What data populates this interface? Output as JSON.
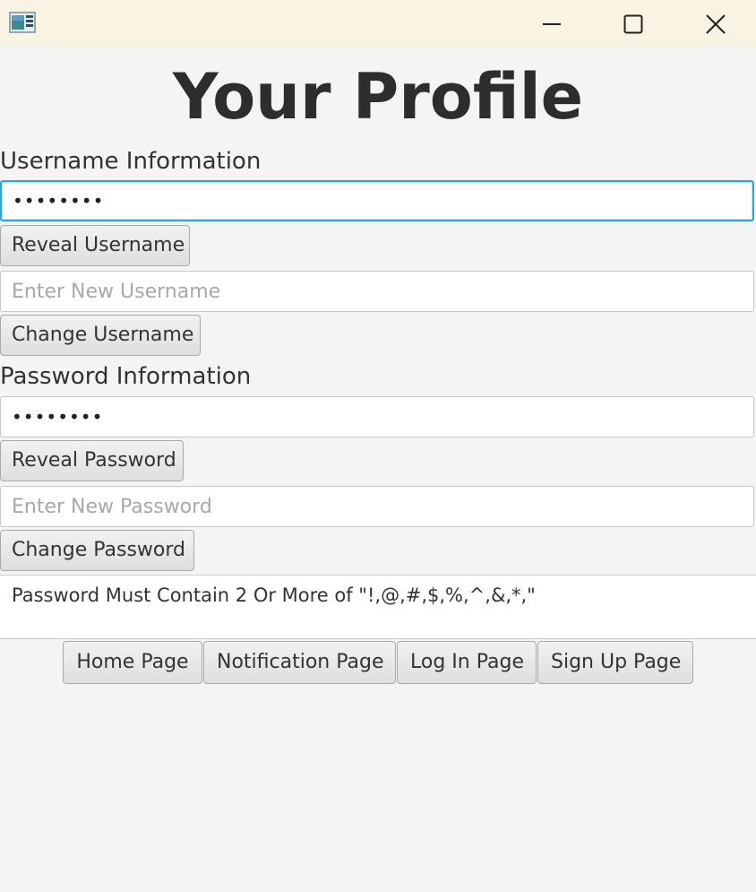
{
  "window": {
    "icons": {
      "app": "app-window-icon",
      "minimize": "minimize-icon",
      "maximize": "maximize-icon",
      "close": "close-icon"
    }
  },
  "page": {
    "title": "Your Profile"
  },
  "username_section": {
    "label": "Username Information",
    "current_value": "••••••••",
    "reveal_button": "Reveal Username",
    "new_placeholder": "Enter New Username",
    "new_value": "",
    "change_button": "Change Username"
  },
  "password_section": {
    "label": "Password Information",
    "current_value": "••••••••",
    "reveal_button": "Reveal Password",
    "new_placeholder": "Enter New Password",
    "new_value": "",
    "change_button": "Change Password"
  },
  "requirement_note": "Password Must Contain 2 Or More of \"!,@,#,$,%,^,&,*,\"",
  "nav": {
    "buttons": [
      "Home Page",
      "Notification Page",
      "Log In Page",
      "Sign Up Page"
    ]
  },
  "colors": {
    "titlebar": "#f8f3e2",
    "background": "#f4f4f4",
    "focus_border": "#2fa4d6"
  }
}
